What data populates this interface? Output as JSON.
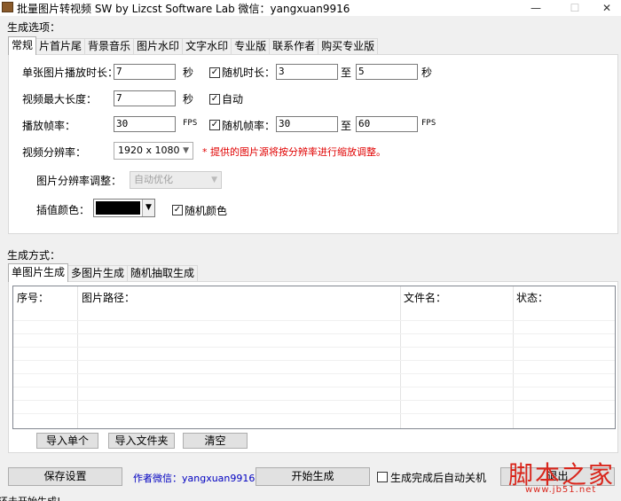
{
  "window": {
    "title": "批量图片转视频 SW  by Lizcst Software Lab  微信：yangxuan9916",
    "minimize_glyph": "—",
    "maximize_glyph": "☐",
    "close_glyph": "✕"
  },
  "options": {
    "group_label": "生成选项：",
    "tabs": [
      "常规",
      "片首片尾",
      "背景音乐",
      "图片水印",
      "文字水印",
      "专业版",
      "联系作者",
      "购买专业版"
    ],
    "active_tab": 0,
    "general": {
      "duration_label": "单张图片播放时长：",
      "duration_value": "7",
      "duration_unit": "秒",
      "random_duration_label": "随机时长：",
      "random_duration_checked": "✓",
      "random_duration_min": "3",
      "random_duration_to": "至",
      "random_duration_max": "5",
      "random_duration_unit": "秒",
      "max_length_label": "视频最大长度：",
      "max_length_value": "7",
      "max_length_unit": "秒",
      "auto_label": "自动",
      "auto_checked": "✓",
      "fps_label": "播放帧率：",
      "fps_value": "30",
      "fps_unit": "FPS",
      "random_fps_label": "随机帧率：",
      "random_fps_checked": "✓",
      "random_fps_min": "30",
      "random_fps_to": "至",
      "random_fps_max": "60",
      "random_fps_unit": "FPS",
      "resolution_label": "视频分辨率：",
      "resolution_value": "1920 x 1080",
      "resolution_note": "* 提供的图片源将按分辨率进行缩放调整。",
      "image_scale_label": "图片分辨率调整：",
      "image_scale_value": "自动优化",
      "fill_color_label": "插值颜色：",
      "fill_color": "#000000",
      "random_color_label": "随机颜色",
      "random_color_checked": "✓"
    }
  },
  "mode": {
    "group_label": "生成方式：",
    "tabs": [
      "单图片生成",
      "多图片生成",
      "随机抽取生成"
    ],
    "active_tab": 0,
    "columns": [
      "序号：",
      "图片路径：",
      "文件名：",
      "状态："
    ],
    "buttons": {
      "import_single": "导入单个",
      "import_folder": "导入文件夹",
      "clear": "清空"
    }
  },
  "bottom": {
    "save_settings": "保存设置",
    "author_wechat": "作者微信：yangxuan9916",
    "start": "开始生成",
    "shutdown_label": "生成完成后自动关机",
    "shutdown_checked": "",
    "exit": "退出"
  },
  "status": {
    "text": "还未开始生成!"
  },
  "watermark": {
    "text": "脚本之家",
    "url": "www.jb51.net"
  },
  "icons": {
    "app": "app-icon",
    "dropdown": "chevron-down-icon",
    "check": "check-icon"
  }
}
